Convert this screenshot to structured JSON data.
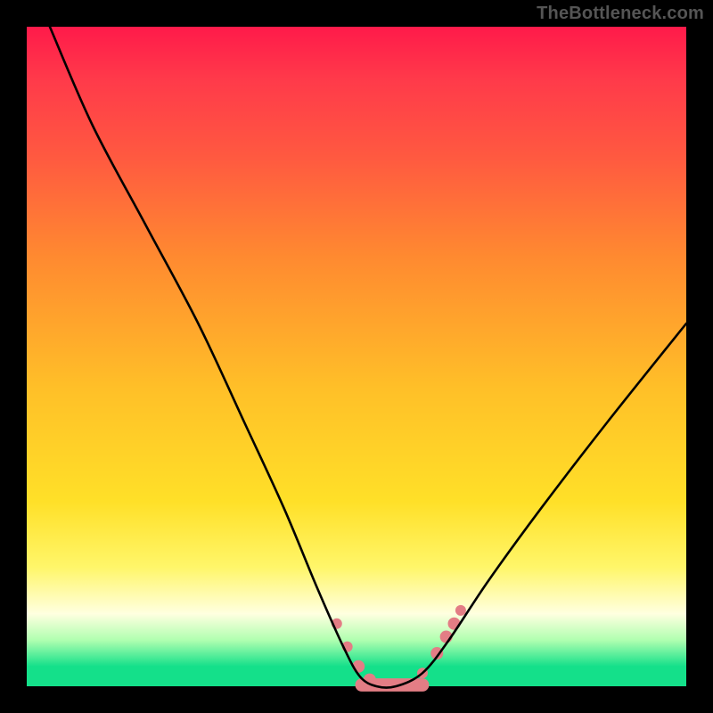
{
  "attribution": "TheBottleneck.com",
  "chart_data": {
    "type": "line",
    "title": "",
    "xlabel": "",
    "ylabel": "",
    "xlim": [
      0,
      1
    ],
    "ylim": [
      0,
      1
    ],
    "legend": false,
    "grid": false,
    "background_gradient": [
      "#ff1a4a",
      "#ff8a30",
      "#ffe028",
      "#ffffe0",
      "#14e08a"
    ],
    "series": [
      {
        "name": "bottleneck-curve",
        "color": "#000000",
        "x": [
          0.035,
          0.1,
          0.18,
          0.26,
          0.33,
          0.39,
          0.44,
          0.48,
          0.505,
          0.53,
          0.56,
          0.6,
          0.64,
          0.7,
          0.78,
          0.88,
          1.0
        ],
        "y": [
          1.0,
          0.85,
          0.7,
          0.55,
          0.4,
          0.27,
          0.15,
          0.06,
          0.015,
          0.0,
          0.0,
          0.02,
          0.07,
          0.16,
          0.27,
          0.4,
          0.55
        ]
      }
    ],
    "markers": [
      {
        "name": "pink-dot",
        "x": 0.47,
        "y": 0.095,
        "r": 6,
        "color": "#e37d85"
      },
      {
        "name": "pink-dot",
        "x": 0.486,
        "y": 0.06,
        "r": 6,
        "color": "#e37d85"
      },
      {
        "name": "pink-dot",
        "x": 0.503,
        "y": 0.03,
        "r": 7,
        "color": "#e37d85"
      },
      {
        "name": "pink-dot",
        "x": 0.52,
        "y": 0.01,
        "r": 7,
        "color": "#e37d85"
      },
      {
        "name": "pink-dot",
        "x": 0.6,
        "y": 0.02,
        "r": 6,
        "color": "#e37d85"
      },
      {
        "name": "pink-dot",
        "x": 0.622,
        "y": 0.05,
        "r": 7,
        "color": "#e37d85"
      },
      {
        "name": "pink-dot",
        "x": 0.636,
        "y": 0.075,
        "r": 7,
        "color": "#e37d85"
      },
      {
        "name": "pink-dot",
        "x": 0.648,
        "y": 0.095,
        "r": 7,
        "color": "#e37d85"
      },
      {
        "name": "pink-dot",
        "x": 0.658,
        "y": 0.115,
        "r": 6,
        "color": "#e37d85"
      }
    ],
    "plateau": {
      "name": "pink-plateau",
      "x0": 0.508,
      "x1": 0.6,
      "y": 0.002,
      "thickness": 0.02,
      "color": "#e37d85"
    }
  }
}
